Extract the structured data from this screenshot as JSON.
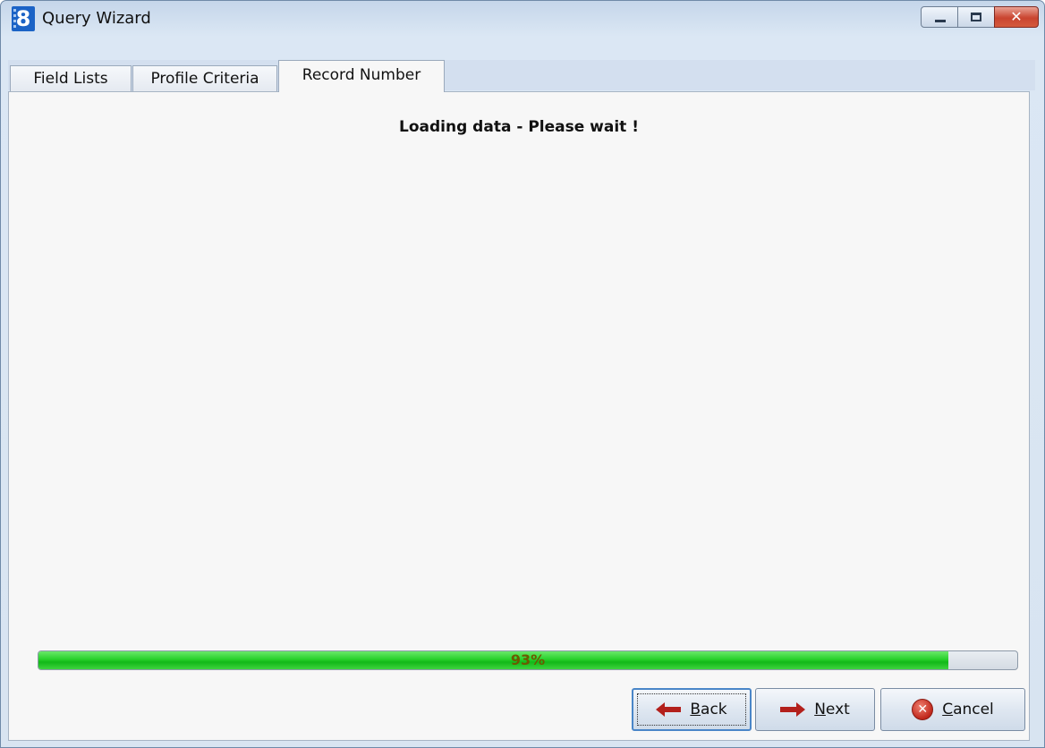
{
  "window": {
    "title": "Query Wizard",
    "app_icon_glyph": "8"
  },
  "tabs": [
    {
      "label": "Field Lists",
      "active": false
    },
    {
      "label": "Profile Criteria",
      "active": false
    },
    {
      "label": "Record Number",
      "active": true
    }
  ],
  "main": {
    "loading_message": "Loading data - Please wait !"
  },
  "progress": {
    "percent": 93,
    "label": "93%"
  },
  "buttons": {
    "back": {
      "mnemonic": "B",
      "rest": "ack"
    },
    "next": {
      "mnemonic": "N",
      "rest": "ext"
    },
    "cancel": {
      "mnemonic": "C",
      "rest": "ancel"
    }
  },
  "colors": {
    "progress_fill": "#22cc22",
    "accent": "#1b63c6",
    "close_button": "#c9442f"
  },
  "icons": {
    "app": "app-logo-icon",
    "back": "arrow-left-icon",
    "next": "arrow-right-icon",
    "cancel": "cancel-icon"
  }
}
